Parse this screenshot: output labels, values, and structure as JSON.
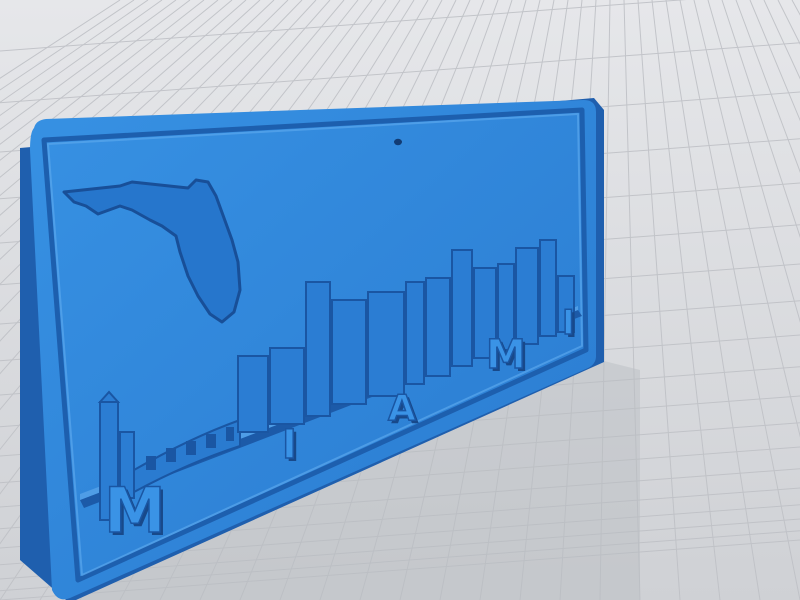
{
  "scene": {
    "subject": "3D-printable license plate model",
    "colors": {
      "background": "#d9dadd",
      "grid_line": "#bfc1c6",
      "plate": "#2f86d8",
      "plate_dark": "#1f5fae",
      "plate_light": "#5aa6ec",
      "plate_shadow": "#18498a"
    }
  },
  "plate": {
    "letters": [
      "M",
      "I",
      "A",
      "M",
      "I"
    ]
  }
}
